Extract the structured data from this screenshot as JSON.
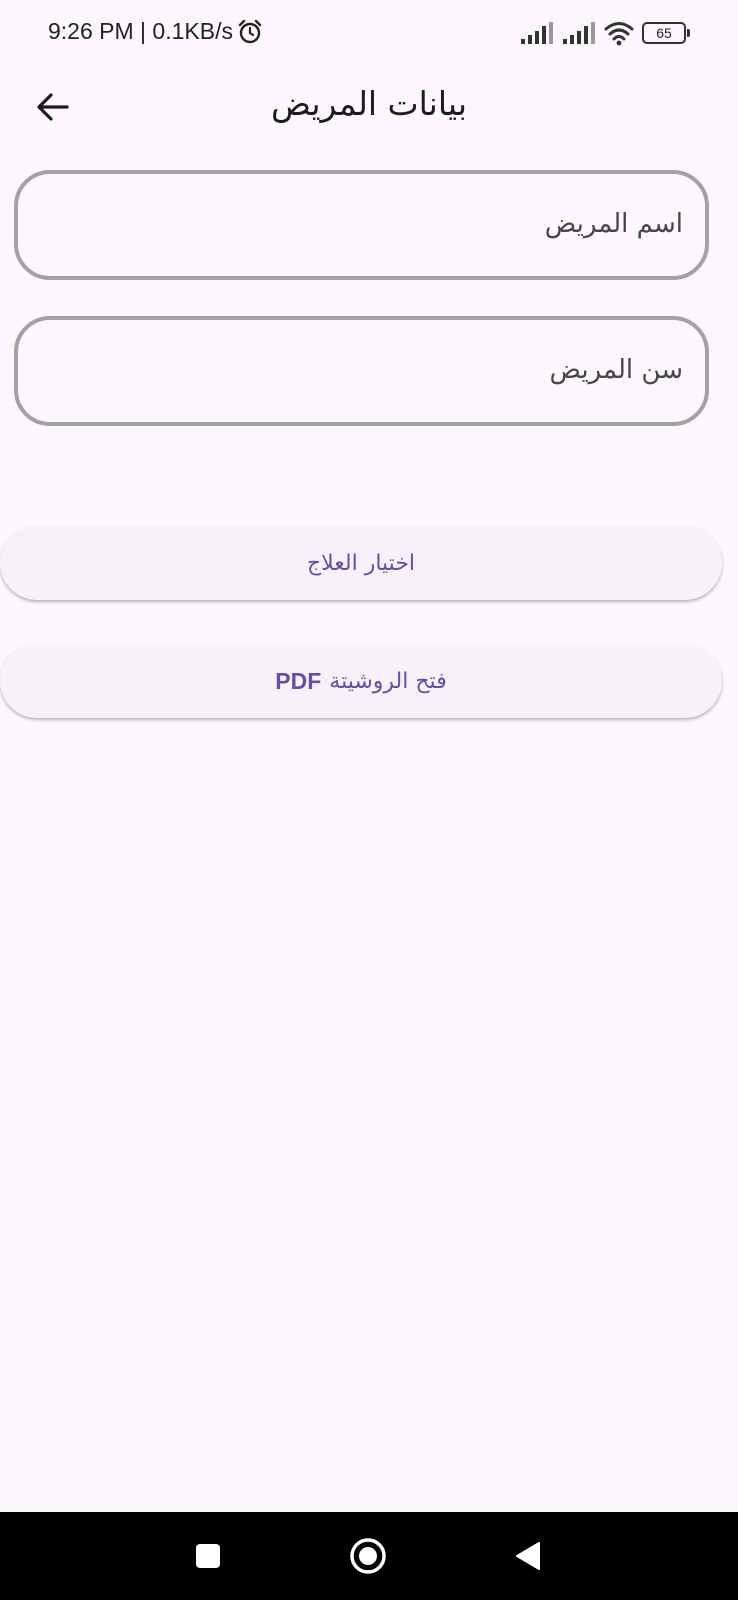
{
  "status_bar": {
    "time": "9:26 PM | 0.1KB/s",
    "battery": "65"
  },
  "app_bar": {
    "title": "بيانات المريض"
  },
  "form": {
    "name_placeholder": "اسم المريض",
    "age_placeholder": "سن المريض"
  },
  "buttons": {
    "treatment_label": "اختيار العلاج",
    "prescription_pdf": "PDF",
    "prescription_label": "فتح الروشيتة"
  },
  "colors": {
    "background": "#fdf8fd",
    "accent": "#6750a4",
    "outline": "#a3a1a6"
  },
  "icons": {
    "back": "arrow-left-icon",
    "alarm": "alarm-clock-icon",
    "signal": "cell-signal-icon",
    "wifi": "wifi-icon",
    "nav_recents": "square-icon",
    "nav_home": "circle-icon",
    "nav_back": "triangle-back-icon"
  }
}
